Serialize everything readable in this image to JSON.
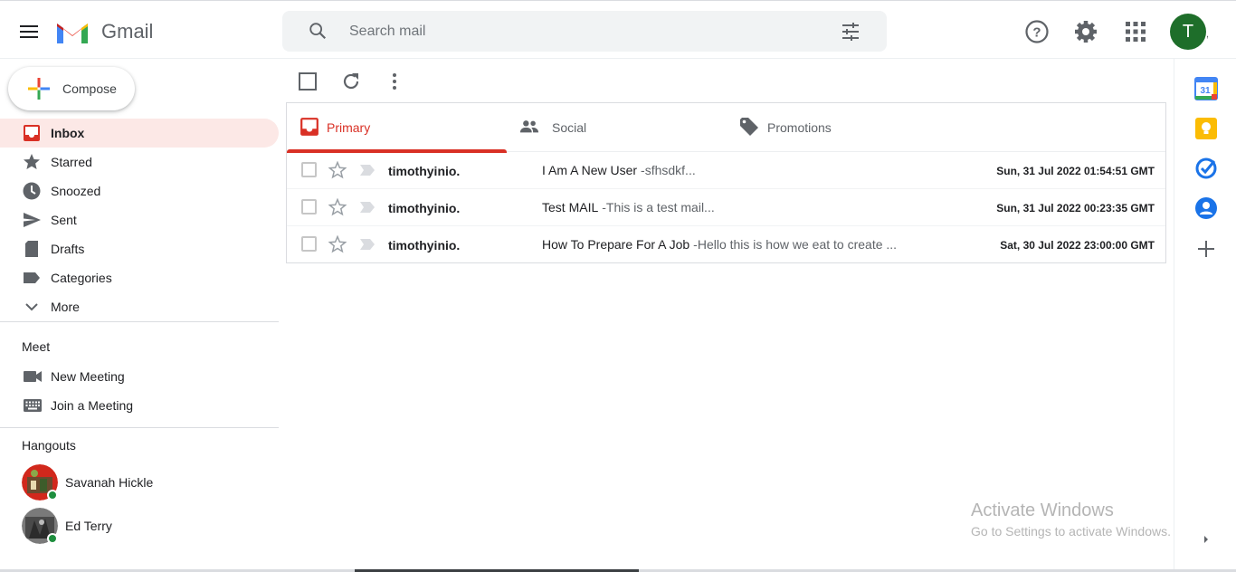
{
  "app": {
    "name": "Gmail",
    "menu_icon": "hamburger-menu-icon",
    "logo_icon": "gmail-logo-icon"
  },
  "search": {
    "placeholder": "Search mail",
    "value": "",
    "search_icon": "search-icon",
    "options_icon": "search-options-icon"
  },
  "header_icons": [
    "help-icon",
    "settings-gear-icon",
    "apps-grid-icon"
  ],
  "account": {
    "initial": "T",
    "trailing": ",",
    "color": "#1e6e2a"
  },
  "compose": {
    "label": "Compose"
  },
  "sidebar": {
    "items": [
      {
        "label": "Inbox",
        "icon": "inbox-icon",
        "active": true
      },
      {
        "label": "Starred",
        "icon": "star-icon"
      },
      {
        "label": "Snoozed",
        "icon": "clock-icon"
      },
      {
        "label": "Sent",
        "icon": "send-icon"
      },
      {
        "label": "Drafts",
        "icon": "draft-icon"
      },
      {
        "label": "Categories",
        "icon": "label-icon"
      },
      {
        "label": "More",
        "icon": "chevron-down-icon"
      }
    ],
    "meet": {
      "title": "Meet",
      "items": [
        {
          "label": "New Meeting",
          "icon": "video-camera-icon"
        },
        {
          "label": "Join a Meeting",
          "icon": "keyboard-icon"
        }
      ]
    },
    "hangouts": {
      "title": "Hangouts",
      "contacts": [
        {
          "name": "Savanah Hickle",
          "status": "online"
        },
        {
          "name": "Ed Terry",
          "status": "online"
        }
      ]
    }
  },
  "toolbar": {
    "icons": [
      "select-all-checkbox",
      "refresh-icon",
      "more-vert-icon"
    ]
  },
  "tabs": [
    {
      "label": "Primary",
      "icon": "inbox-icon",
      "active": true
    },
    {
      "label": "Social",
      "icon": "people-icon"
    },
    {
      "label": "Promotions",
      "icon": "tag-icon"
    }
  ],
  "emails": [
    {
      "sender": "timothyinio.",
      "subject": "I Am A New User",
      "snippet": "-sfhsdkf...",
      "date": "Sun, 31 Jul 2022 01:54:51 GMT"
    },
    {
      "sender": "timothyinio.",
      "subject": "Test MAIL",
      "snippet": "-This is a test mail...",
      "date": "Sun, 31 Jul 2022 00:23:35 GMT"
    },
    {
      "sender": "timothyinio.",
      "subject": "How To Prepare For A Job",
      "snippet": "-Hello this is how we eat to create ...",
      "date": "Sat, 30 Jul 2022 23:00:00 GMT"
    }
  ],
  "right_panel": {
    "icons": [
      "calendar-icon",
      "keep-icon",
      "tasks-icon",
      "contacts-icon",
      "add-icon",
      "expand-arrow-icon"
    ],
    "calendar_day": "31"
  },
  "watermark": {
    "title": "Activate Windows",
    "subtitle": "Go to Settings to activate Windows."
  },
  "colors": {
    "accent": "#d93025",
    "active_bg": "#fce8e6"
  }
}
